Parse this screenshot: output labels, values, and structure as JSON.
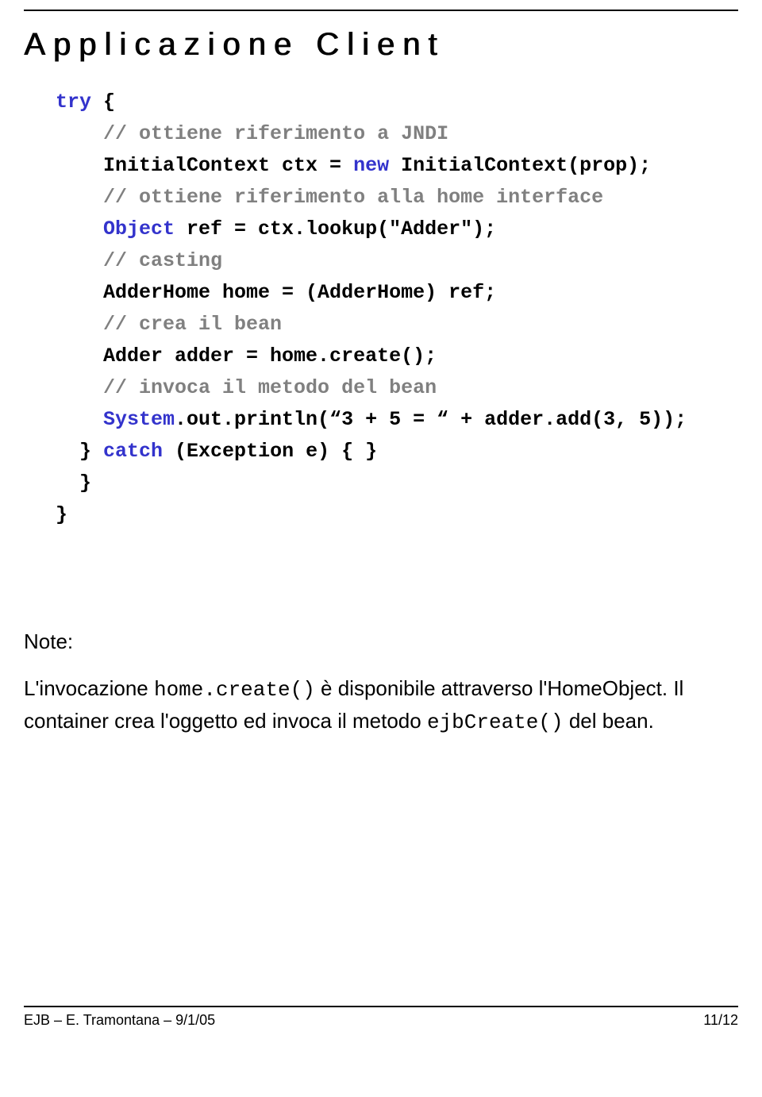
{
  "title": "Applicazione Client",
  "code": {
    "l1_kw": "try",
    "l1_rest": " {",
    "l2_comment": "// ottiene riferimento a JNDI",
    "l3_a": "InitialContext ctx = ",
    "l3_kw": "new",
    "l3_b": " InitialContext(prop);",
    "l4_comment": "// ottiene riferimento alla home interface",
    "l5_type": "Object",
    "l5_rest": " ref = ctx.lookup(\"Adder\");",
    "l6_comment": "// casting",
    "l7": "AdderHome home = (AdderHome) ref;",
    "l8_comment": "// crea il bean",
    "l9": "Adder adder = home.create();",
    "l10_comment": "// invoca il metodo del bean",
    "l11_type": "System",
    "l11_rest": ".out.println(“3 + 5 = “ + adder.add(3, 5));",
    "l12_a": "} ",
    "l12_kw": "catch",
    "l12_b": " (Exception e) { }",
    "l13": "  }",
    "l14": "}"
  },
  "notes": {
    "label": "Note:",
    "p1_a": "L'invocazione ",
    "p1_mono1": "home.create()",
    "p1_b": " è disponibile attraverso l'HomeObject.  Il container crea l'oggetto ed invoca il metodo ",
    "p1_mono2": "ejbCreate()",
    "p1_c": " del bean."
  },
  "footer": {
    "left": "EJB  – E. Tramontana – 9/1/05",
    "right": "11/12"
  }
}
